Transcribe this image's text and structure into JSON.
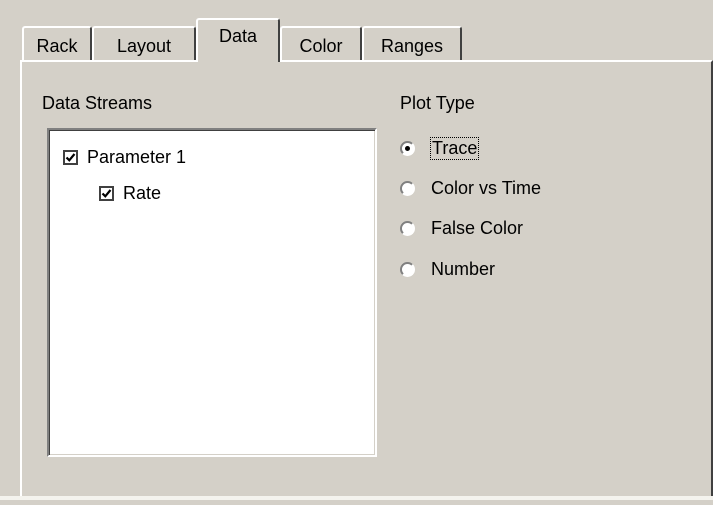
{
  "tabs": [
    {
      "label": "Rack",
      "active": false
    },
    {
      "label": "Layout",
      "active": false
    },
    {
      "label": "Data",
      "active": true
    },
    {
      "label": "Color",
      "active": false
    },
    {
      "label": "Ranges",
      "active": false
    }
  ],
  "data_streams": {
    "label": "Data Streams",
    "items": [
      {
        "label": "Parameter 1",
        "checked": true,
        "level": 0
      },
      {
        "label": "Rate",
        "checked": true,
        "level": 1
      }
    ]
  },
  "plot_type": {
    "label": "Plot Type",
    "selected": "Trace",
    "options": [
      {
        "label": "Trace",
        "selected": true
      },
      {
        "label": "Color vs Time",
        "selected": false
      },
      {
        "label": "False Color",
        "selected": false
      },
      {
        "label": "Number",
        "selected": false
      }
    ]
  },
  "colors": {
    "face": "#d4d0c8",
    "highlight": "#ffffff",
    "shadow": "#808080",
    "dark_shadow": "#404040",
    "window": "#ffffff"
  }
}
